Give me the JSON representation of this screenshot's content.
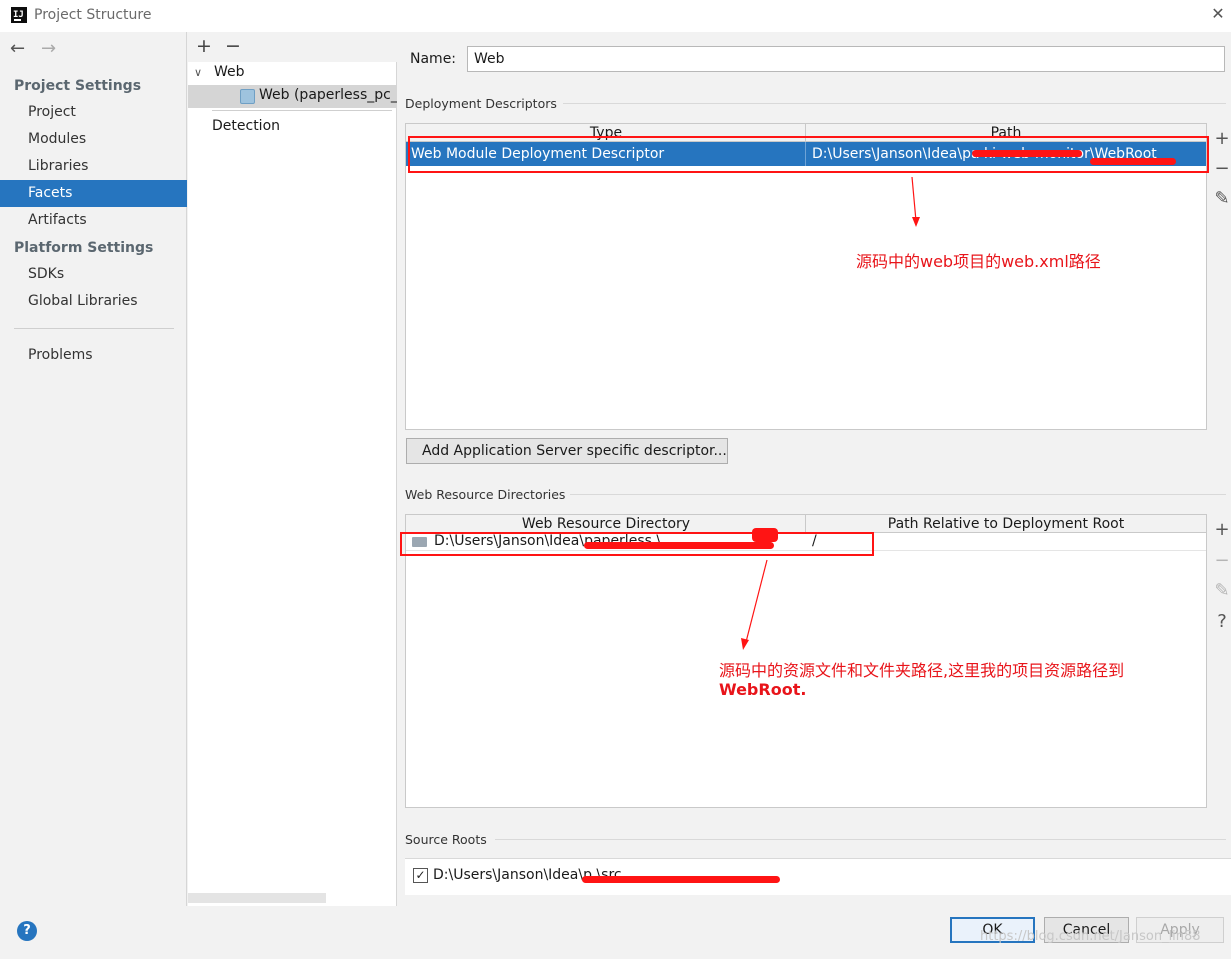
{
  "window": {
    "title": "Project Structure",
    "logo_text": "IJ",
    "close_glyph": "✕"
  },
  "sidebar": {
    "back_glyph": "←",
    "forward_glyph": "→",
    "project_settings_title": "Project Settings",
    "platform_settings_title": "Platform Settings",
    "items": [
      {
        "label": "Project"
      },
      {
        "label": "Modules"
      },
      {
        "label": "Libraries"
      },
      {
        "label": "Facets",
        "selected": true
      },
      {
        "label": "Artifacts"
      },
      {
        "label": "SDKs"
      },
      {
        "label": "Global Libraries"
      },
      {
        "label": "Problems"
      }
    ]
  },
  "tree": {
    "add_glyph": "+",
    "remove_glyph": "−",
    "chevron_glyph": "∨",
    "root_label": "Web",
    "child_label": "Web (paperless_pc_k",
    "detection_label": "Detection"
  },
  "facet": {
    "name_label": "Name:",
    "name_value": "Web",
    "deployment_descriptors": {
      "title": "Deployment Descriptors",
      "columns": [
        "Type",
        "Path"
      ],
      "rows": [
        {
          "type": "Web Module Deployment Descriptor",
          "path": "D:\\Users\\Janson\\Idea\\pa                ki-web-monitor\\WebRoot"
        }
      ],
      "add_server_descriptor_button": "Add Application Server specific descriptor..."
    },
    "web_resource_directories": {
      "title": "Web Resource Directories",
      "columns": [
        "Web Resource Directory",
        "Path Relative to Deployment Root"
      ],
      "rows": [
        {
          "directory": "D:\\Users\\Janson\\Idea\\paperless                          \\...",
          "relative_path": "/"
        }
      ]
    },
    "source_roots": {
      "title": "Source Roots",
      "check_glyph": "✓",
      "items": [
        {
          "path": "D:\\Users\\Janson\\Idea\\p                               \\src",
          "checked": true
        }
      ]
    },
    "side_tools": {
      "add": "+",
      "remove": "−",
      "edit": "✎",
      "help": "?"
    }
  },
  "buttons": {
    "help": "?",
    "ok": "OK",
    "cancel": "Cancel",
    "apply": "Apply"
  },
  "annotations": {
    "descriptor_note": "源码中的web项目的web.xml路径",
    "resource_note_line1": "源码中的资源文件和文件夹路径,这里我的项目资源路径到",
    "resource_note_line2": "WebRoot.",
    "color": "#ff1414"
  },
  "watermark": "https://blog.csdn.net/Janson_lin88",
  "colors": {
    "selection": "#2675bf",
    "annotation_red": "#ff1414"
  }
}
